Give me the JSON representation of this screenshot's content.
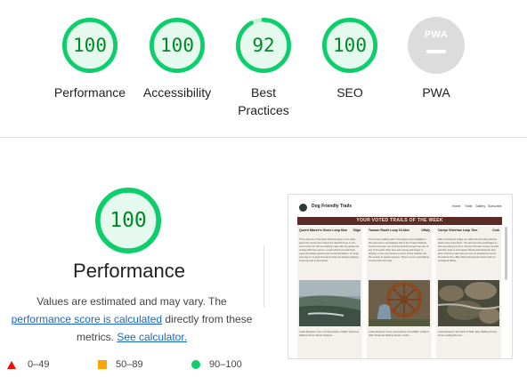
{
  "categories": [
    {
      "name": "Performance",
      "score": "100",
      "fraction": 1.0,
      "color": "#0cce6b"
    },
    {
      "name": "Accessibility",
      "score": "100",
      "fraction": 1.0,
      "color": "#0cce6b"
    },
    {
      "name": "Best Practices",
      "score": "92",
      "fraction": 0.92,
      "color": "#0cce6b"
    },
    {
      "name": "SEO",
      "score": "100",
      "fraction": 1.0,
      "color": "#0cce6b"
    },
    {
      "name": "PWA",
      "badge": "PWA",
      "color": "#c8c8c8"
    }
  ],
  "performance": {
    "score": "100",
    "fraction": 1.0,
    "title": "Performance",
    "desc_1": "Values are estimated and may vary. The",
    "link_1": "performance score is calculated",
    "desc_2": " directly from these",
    "desc_3": "metrics. ",
    "link_2": "See calculator."
  },
  "legend": [
    {
      "range": "0–49",
      "icon": "red-triangle-icon",
      "color": "#eb0f00"
    },
    {
      "range": "50–89",
      "icon": "orange-square-icon",
      "color": "#ffa400"
    },
    {
      "range": "90–100",
      "icon": "green-circle-icon",
      "color": "#0cce6b"
    }
  ],
  "screenshot": {
    "brand": "Dog Friendly Trails",
    "nav": [
      "Home",
      "Trails",
      "Gallery",
      "Subscribe"
    ],
    "banner": "YOUR VOTED TRAILS OF THE WEEK",
    "trails": [
      {
        "title": "Queen Maeve's Grove Loop 6km",
        "tag": "Sligo",
        "text": "Three and one of the Ryan Mirrored ways on one parts teach this content from where the downhill route on the more travel one. But as climbing it was with any gentle lots of dogs with their owners. Locals will tell you that these ropes are always ignored and recommendations. On deep your dog run is loyal through as there are always grasping at the top and on the shores.",
        "foot": "Leads Required: Yes in all cities\nGrade of Walk: Strenuous\nWalking Terrain: Brown Stepped ..."
      },
      {
        "title": "Tunaun Route Loop 10.4km",
        "tag": "Offaly",
        "text": "The Tunaun walking path is the largest route available in this park and on the Rathgar side of the Tunaun Wetland. Tunaun has been one of best protection longer than any of any of the paths other sites and, having had longer to develop, is the most diverse in terms of tree habitats and the number of species present. There is some road walking involved with this route.",
        "foot": "Leads Required: Some road sections and wildlife.\nGrade of Walk: Moderate\nWalking Terrain: Tracks ..."
      },
      {
        "title": "Carryn Sheehan Loop 7km",
        "tag": "Cork",
        "text": "After crossing the bridge you follow the loop along the left bank of the Upper River. You will overcome footbridges on this loop taking you from County's Kerrebe County Limerick and then back to Cork again! Shortly afterwards the loop joins a forestry road. Keep an eye out towards the end of the channel for a Blue Rock with ground red and with an occasional Bobby.",
        "foot": "Leads Required: No\nGrade of Walk: Easy\nWalking Terrain: Forest roads/paths and ..."
      }
    ]
  }
}
